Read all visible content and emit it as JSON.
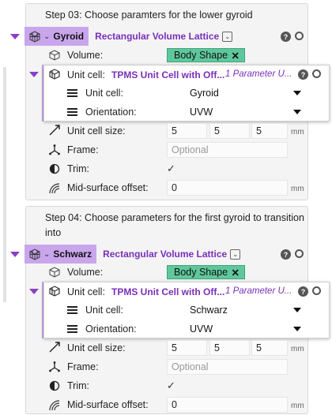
{
  "steps": [
    {
      "title": "Step 03: Choose paramters for the lower gyroid",
      "node": {
        "name": "Gyroid",
        "type": "Rectangular Volume Lattice",
        "icon": "lattice-cube-icon"
      },
      "volume": {
        "label": "Volume:",
        "value": "Body Shape"
      },
      "unit_cell_node": {
        "label": "Unit cell:",
        "name": "TPMS Unit Cell with Off...",
        "params": "1 Parameter U..."
      },
      "unit_cell_select": {
        "label": "Unit cell:",
        "value": "Gyroid"
      },
      "orientation": {
        "label": "Orientation:",
        "value": "UVW"
      },
      "unit_cell_size": {
        "label": "Unit cell size:",
        "values": [
          "5",
          "5",
          "5"
        ],
        "unit": "mm"
      },
      "frame": {
        "label": "Frame:",
        "placeholder": "Optional"
      },
      "trim": {
        "label": "Trim:",
        "checked": "✓"
      },
      "mid_surface_offset": {
        "label": "Mid-surface offset:",
        "value": "0",
        "unit": "mm"
      }
    },
    {
      "title": "Step 04: Choose parameters for the first gyroid to transition into",
      "node": {
        "name": "Schwarz",
        "type": "Rectangular Volume Lattice",
        "icon": "lattice-cube-icon"
      },
      "volume": {
        "label": "Volume:",
        "value": "Body Shape"
      },
      "unit_cell_node": {
        "label": "Unit cell:",
        "name": "TPMS Unit Cell with Off...",
        "params": "1 Parameter U..."
      },
      "unit_cell_select": {
        "label": "Unit cell:",
        "value": "Schwarz"
      },
      "orientation": {
        "label": "Orientation:",
        "value": "UVW"
      },
      "unit_cell_size": {
        "label": "Unit cell size:",
        "values": [
          "5",
          "5",
          "5"
        ],
        "unit": "mm"
      },
      "frame": {
        "label": "Frame:",
        "placeholder": "Optional"
      },
      "trim": {
        "label": "Trim:",
        "checked": "✓"
      },
      "mid_surface_offset": {
        "label": "Mid-surface offset:",
        "value": "0",
        "unit": "mm"
      }
    }
  ],
  "colors": {
    "node_tag_bg": "#c9a6ec",
    "node_type_text": "#7a2fb8",
    "chip_green": "#5fc79c",
    "collapse_arrow": "#8a3fc7"
  },
  "icons": {
    "help": "?",
    "chip_remove": "✕",
    "dropdown_chevron": "⌄"
  }
}
